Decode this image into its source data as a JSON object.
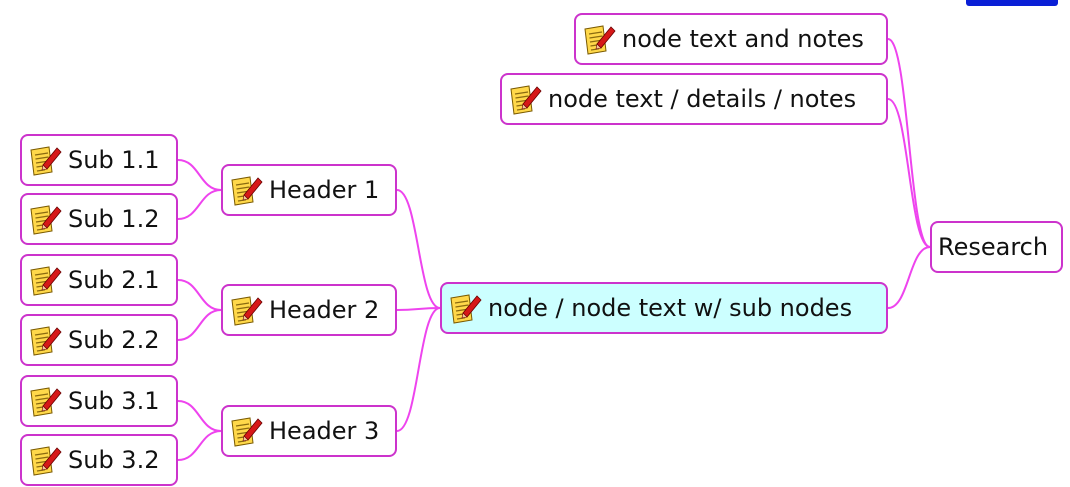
{
  "mindmap": {
    "root": {
      "label": "Research"
    },
    "nodes": [
      {
        "id": "n1",
        "label": "node text and notes",
        "icon": "notes-pencil-icon"
      },
      {
        "id": "n2",
        "label": "node text / details / notes",
        "icon": "notes-pencil-icon"
      },
      {
        "id": "n3",
        "label": "node / node text w/ sub nodes",
        "icon": "notes-pencil-icon",
        "selected": true
      },
      {
        "id": "h1",
        "label": "Header 1",
        "icon": "notes-pencil-icon"
      },
      {
        "id": "h2",
        "label": "Header 2",
        "icon": "notes-pencil-icon"
      },
      {
        "id": "h3",
        "label": "Header 3",
        "icon": "notes-pencil-icon"
      },
      {
        "id": "s11",
        "label": "Sub 1.1",
        "icon": "notes-pencil-icon"
      },
      {
        "id": "s12",
        "label": "Sub 1.2",
        "icon": "notes-pencil-icon"
      },
      {
        "id": "s21",
        "label": "Sub 2.1",
        "icon": "notes-pencil-icon"
      },
      {
        "id": "s22",
        "label": "Sub 2.2",
        "icon": "notes-pencil-icon"
      },
      {
        "id": "s31",
        "label": "Sub 3.1",
        "icon": "notes-pencil-icon"
      },
      {
        "id": "s32",
        "label": "Sub 3.2",
        "icon": "notes-pencil-icon"
      }
    ],
    "edges": [
      [
        "root",
        "n1"
      ],
      [
        "root",
        "n2"
      ],
      [
        "root",
        "n3"
      ],
      [
        "n3",
        "h1"
      ],
      [
        "n3",
        "h2"
      ],
      [
        "n3",
        "h3"
      ],
      [
        "h1",
        "s11"
      ],
      [
        "h1",
        "s12"
      ],
      [
        "h2",
        "s21"
      ],
      [
        "h2",
        "s22"
      ],
      [
        "h3",
        "s31"
      ],
      [
        "h3",
        "s32"
      ]
    ]
  },
  "colors": {
    "border": "#cc33cc",
    "connector": "#ee44ee",
    "selected_fill": "#ccffff",
    "scrollbar": "#0a1fd6"
  }
}
